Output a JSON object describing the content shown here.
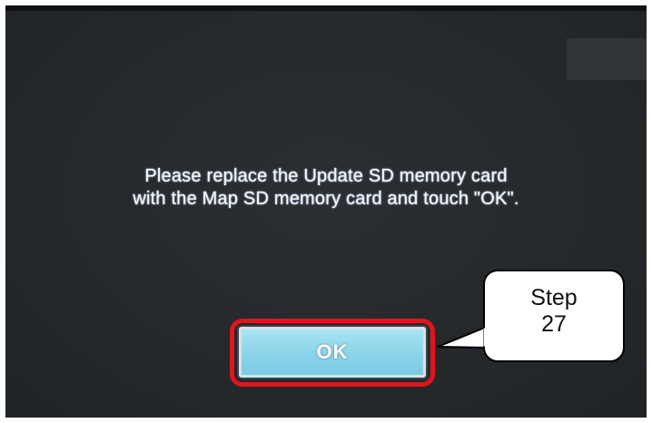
{
  "dialog": {
    "message_line1": "Please replace the Update SD memory card",
    "message_line2": "with the Map SD memory card and touch \"OK\".",
    "ok_label": "OK"
  },
  "callout": {
    "line1": "Step",
    "line2": "27"
  },
  "colors": {
    "screen_background": "#262a2d",
    "button_fill": "#8fd6ea",
    "highlight_border": "#e3141c",
    "message_text": "#f4f6f8"
  }
}
